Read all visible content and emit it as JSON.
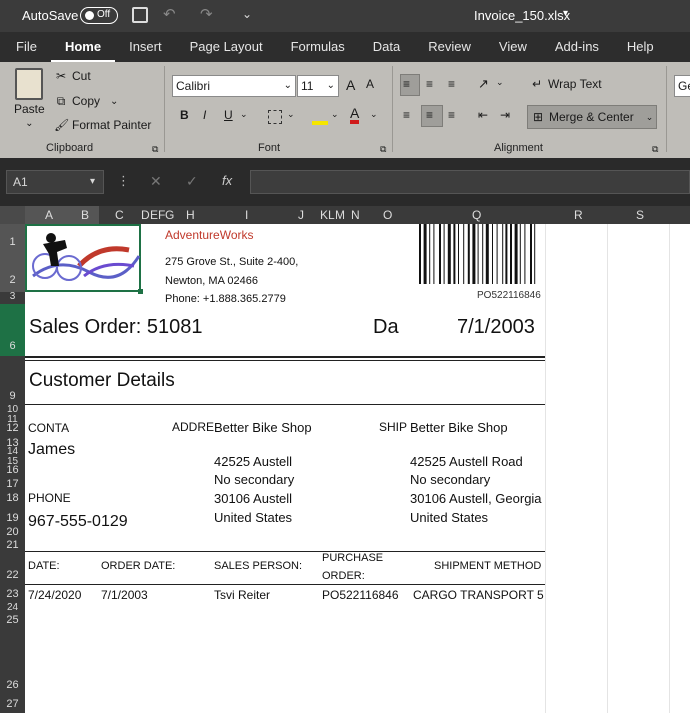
{
  "titlebar": {
    "autosave_label": "AutoSave",
    "autosave_state": "Off",
    "filename": "Invoice_150.xlsx"
  },
  "menu": {
    "tabs": [
      "File",
      "Home",
      "Insert",
      "Page Layout",
      "Formulas",
      "Data",
      "Review",
      "View",
      "Add-ins",
      "Help"
    ]
  },
  "ribbon": {
    "clipboard": {
      "paste": "Paste",
      "cut": "Cut",
      "copy": "Copy",
      "format_painter": "Format Painter",
      "label": "Clipboard"
    },
    "font": {
      "name": "Calibri",
      "size": "11",
      "grow": "A",
      "shrink": "A",
      "bold": "B",
      "italic": "I",
      "underline": "U",
      "color_letter": "A",
      "label": "Font"
    },
    "alignment": {
      "wrap": "Wrap Text",
      "merge": "Merge & Center",
      "label": "Alignment"
    },
    "number_cut": "Ge"
  },
  "formula_bar": {
    "name_box": "A1",
    "fx": "fx"
  },
  "columns": [
    "A",
    "B",
    "C",
    "D",
    "E",
    "F",
    "G",
    "H",
    "I",
    "J",
    "K",
    "L",
    "M",
    "N",
    "O",
    "Q",
    "R",
    "S"
  ],
  "rows": [
    "1",
    "2",
    "3",
    "6",
    "9",
    "10",
    "11",
    "12",
    "13",
    "14",
    "15",
    "16",
    "17",
    "18",
    "19",
    "20",
    "21",
    "22",
    "23",
    "24",
    "25",
    "26",
    "27"
  ],
  "sheet": {
    "company": "AdventureWorks",
    "address1": "275 Grove St., Suite 2-400,",
    "address2": "Newton, MA 02466",
    "phone": "Phone: +1.888.365.2779",
    "barcode_text": "PO522116846",
    "sales_order": "Sales Order: 51081",
    "date_label": "Da",
    "date_value": "7/1/2003",
    "customer_details": "Customer Details",
    "contact_label": "CONTA",
    "contact_value": "James",
    "address_label": "ADDRE",
    "bill_name": "Better Bike Shop",
    "bill_street": "42525 Austell",
    "bill_secondary": "No secondary",
    "bill_city": "30106 Austell",
    "bill_country": "United States",
    "ship_label": "SHIP",
    "ship_name": "Better Bike Shop",
    "ship_street": "42525 Austell Road",
    "ship_secondary": "No secondary",
    "ship_city": "30106 Austell, Georgia",
    "ship_country": "United States",
    "phone_label": "PHONE",
    "phone_value": "967-555-0129",
    "table_headers": {
      "date": "DATE:",
      "order_date": "ORDER DATE:",
      "sales_person": "SALES PERSON:",
      "purchase1": "PURCHASE",
      "purchase2": "ORDER:",
      "shipment": "SHIPMENT METHOD"
    },
    "table_row": {
      "date": "7/24/2020",
      "order_date": "7/1/2003",
      "sales_person": "Tsvi Reiter",
      "po": "PO522116846",
      "shipment": "CARGO TRANSPORT 5"
    }
  },
  "colors": {
    "accent_red": "#c0392b",
    "excel_green": "#1e7145"
  }
}
